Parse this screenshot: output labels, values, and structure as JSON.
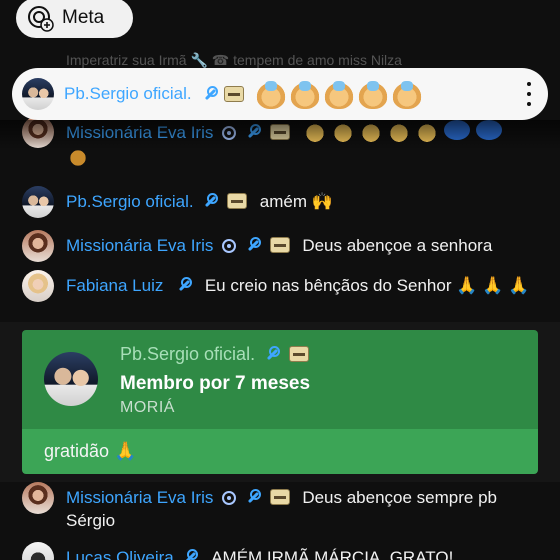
{
  "meta_button": {
    "label": "Meta"
  },
  "faded_row": {
    "text": "Imperatriz sua Irmã 🔧 ☎ tempem de amo miss Nilza"
  },
  "pinned": {
    "author": "Pb.Sergio oficial.",
    "emoji_count": 5
  },
  "messages": [
    {
      "author": "Missionária Eva Iris",
      "text": ""
    },
    {
      "author": "Pb.Sergio oficial.",
      "text": "amém 🙌"
    },
    {
      "author": "Missionária Eva Iris",
      "text": "Deus abençoe a senhora"
    },
    {
      "author": "Fabiana Luiz",
      "text": "Eu creio nas bênçãos do Senhor 🙏 🙏 🙏"
    },
    {
      "author": "Missionária Eva Iris",
      "text": "Deus abençoe sempre pb Sérgio"
    },
    {
      "author": "Lucas Oliveira",
      "text": "AMÉM IRMÃ MÁRCIA, GRATO!"
    }
  ],
  "membership": {
    "author": "Pb.Sergio oficial.",
    "title": "Membro por 7 meses",
    "level": "MORIÁ",
    "message": "gratidão 🙏"
  }
}
